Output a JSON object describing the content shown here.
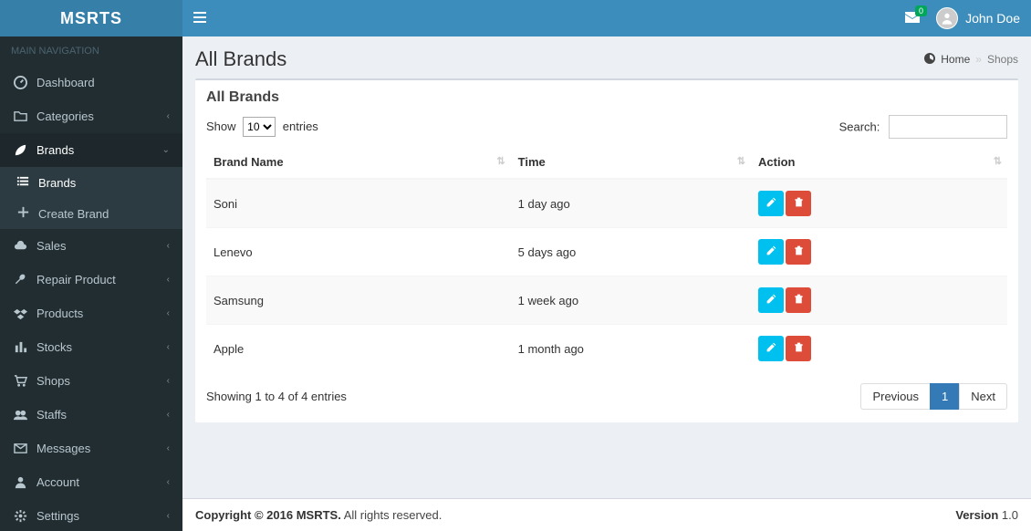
{
  "brand": "MSRTS",
  "header": {
    "messages_badge": "0",
    "user_name": "John Doe"
  },
  "sidebar": {
    "header": "MAIN NAVIGATION",
    "items": [
      {
        "label": "Dashboard",
        "icon": "dashboard"
      },
      {
        "label": "Categories",
        "icon": "folder",
        "caret": true
      },
      {
        "label": "Brands",
        "icon": "leaf",
        "caret": true,
        "open": true,
        "children": [
          {
            "label": "Brands",
            "icon": "list",
            "current": true
          },
          {
            "label": "Create Brand",
            "icon": "plus"
          }
        ]
      },
      {
        "label": "Sales",
        "icon": "cloud",
        "caret": true
      },
      {
        "label": "Repair Product",
        "icon": "wrench",
        "caret": true
      },
      {
        "label": "Products",
        "icon": "dropbox",
        "caret": true
      },
      {
        "label": "Stocks",
        "icon": "bar",
        "caret": true
      },
      {
        "label": "Shops",
        "icon": "cart",
        "caret": true
      },
      {
        "label": "Staffs",
        "icon": "users",
        "caret": true
      },
      {
        "label": "Messages",
        "icon": "envelope",
        "caret": true
      },
      {
        "label": "Account",
        "icon": "user",
        "caret": true
      },
      {
        "label": "Settings",
        "icon": "gear",
        "caret": true
      }
    ]
  },
  "page": {
    "title": "All Brands",
    "breadcrumb_home": "Home",
    "breadcrumb_current": "Shops",
    "box_title": "All Brands"
  },
  "datatable": {
    "show_label": "Show",
    "entries_label": "entries",
    "length_options": [
      "10"
    ],
    "length_selected": "10",
    "search_label": "Search:",
    "columns": [
      "Brand Name",
      "Time",
      "Action"
    ],
    "rows": [
      {
        "name": "Soni",
        "time": "1 day ago"
      },
      {
        "name": "Lenevo",
        "time": "5 days ago"
      },
      {
        "name": "Samsung",
        "time": "1 week ago"
      },
      {
        "name": "Apple",
        "time": "1 month ago"
      }
    ],
    "info": "Showing 1 to 4 of 4 entries",
    "pagination": {
      "prev": "Previous",
      "pages": [
        "1"
      ],
      "active": "1",
      "next": "Next"
    }
  },
  "footer": {
    "copyright": "Copyright © 2016 MSRTS.",
    "rights": " All rights reserved.",
    "version_label": "Version",
    "version": " 1.0"
  }
}
